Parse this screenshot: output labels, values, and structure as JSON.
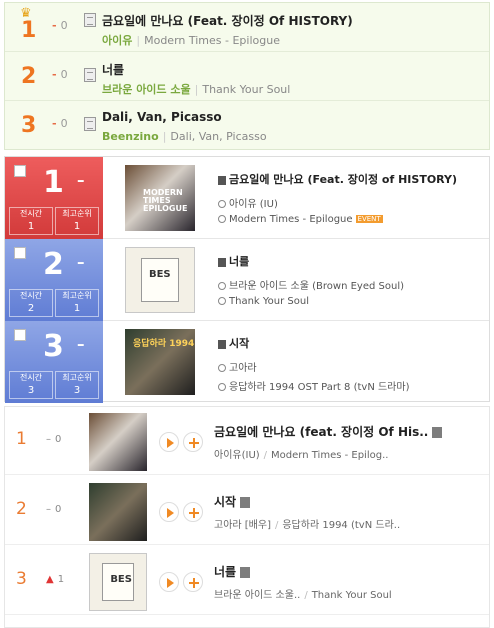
{
  "section1": {
    "crown_icon": "crown-icon",
    "rows": [
      {
        "rank": "1",
        "change": "0",
        "title": "금요일에 만나요 (Feat. 장이정 Of HISTORY)",
        "artist": "아이유",
        "album": "Modern Times - Epilogue"
      },
      {
        "rank": "2",
        "change": "0",
        "title": "너를",
        "artist": "브라운 아이드 소울",
        "album": "Thank Your Soul"
      },
      {
        "rank": "3",
        "change": "0",
        "title": "Dali, Van, Picasso",
        "artist": "Beenzino",
        "album": "Dali, Van, Picasso"
      }
    ]
  },
  "section2": {
    "rows": [
      {
        "rank": "1",
        "dash": "–",
        "stat1_label": "전시간",
        "stat1_value": "1",
        "stat2_label": "최고순위",
        "stat2_value": "1",
        "title": "금요일에 만나요 (Feat. 장이정 of HISTORY)",
        "artist": "아이유 (IU)",
        "album": "Modern Times - Epilogue",
        "badge": "EVENT",
        "cover_text": "MODERN TIMES EPILOGUE"
      },
      {
        "rank": "2",
        "dash": "–",
        "stat1_label": "전시간",
        "stat1_value": "2",
        "stat2_label": "최고순위",
        "stat2_value": "1",
        "title": "너를",
        "artist": "브라운 아이드 소울 (Brown Eyed Soul)",
        "album": "Thank Your Soul"
      },
      {
        "rank": "3",
        "dash": "–",
        "stat1_label": "전시간",
        "stat1_value": "3",
        "stat2_label": "최고순위",
        "stat2_value": "3",
        "title": "시작",
        "artist": "고아라",
        "album": "응답하라 1994 OST Part 8 (tvN 드라마)",
        "cover_text": "응답하라 1994"
      }
    ]
  },
  "section3": {
    "rows": [
      {
        "rank": "1",
        "change": "0",
        "title": "금요일에 만나요 (feat. 장이정 Of His..",
        "artist": "아이유(IU)",
        "album": "Modern Times - Epilog.."
      },
      {
        "rank": "2",
        "change": "0",
        "title": "시작",
        "artist": "고아라 [배우]",
        "album": "응답하라 1994 (tvN 드라.."
      },
      {
        "rank": "3",
        "change": "1",
        "change_dir": "up",
        "title": "너를",
        "artist": "브라운 아이드 소울..",
        "album": "Thank Your Soul"
      }
    ]
  },
  "colors": {
    "rank_orange": "#ee7521",
    "green_artist": "#7aa83e",
    "red_box": "#d23a3a",
    "blue_box": "#5f7cd4"
  }
}
